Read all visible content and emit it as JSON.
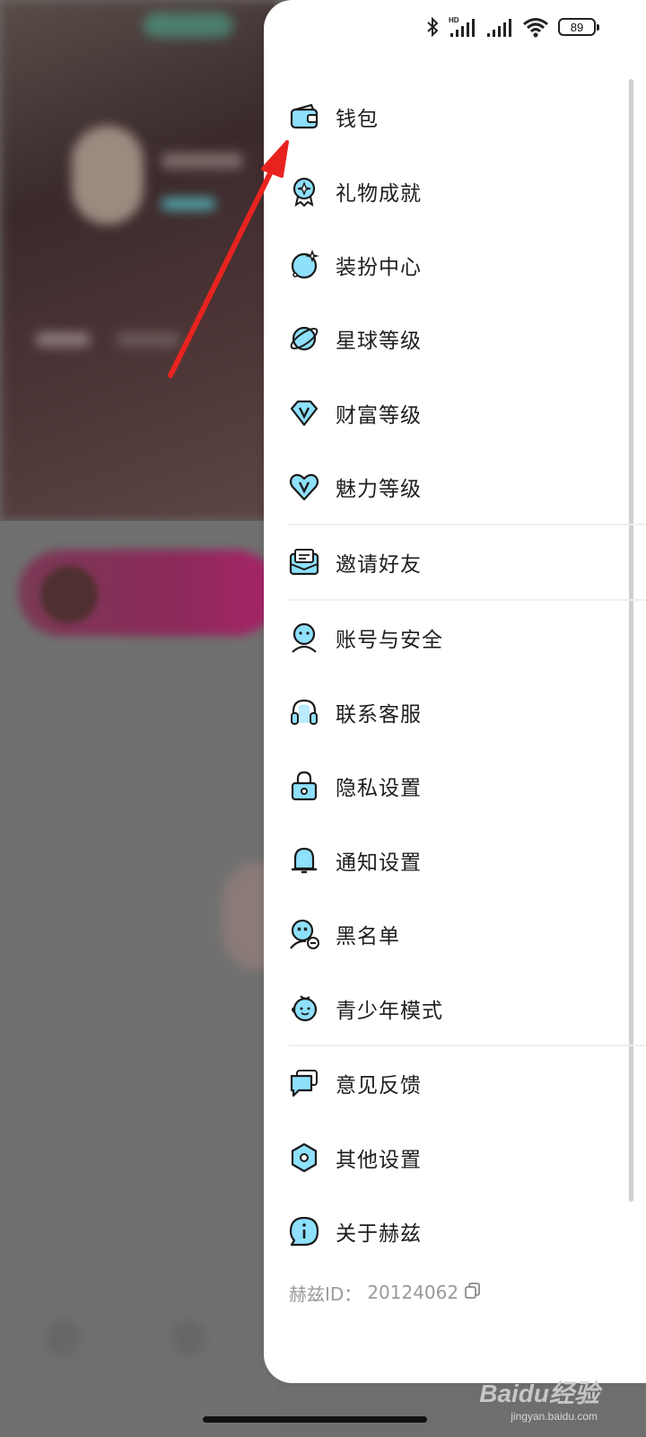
{
  "status_bar": {
    "battery": "89",
    "network_badge": "HD"
  },
  "menu": {
    "items": [
      {
        "label": "钱包",
        "icon": "wallet-icon"
      },
      {
        "label": "礼物成就",
        "icon": "gift-medal-icon"
      },
      {
        "label": "装扮中心",
        "icon": "planet-sparkle-icon"
      },
      {
        "label": "星球等级",
        "icon": "planet-ring-icon"
      },
      {
        "label": "财富等级",
        "icon": "diamond-v-icon"
      },
      {
        "label": "魅力等级",
        "icon": "heart-v-icon"
      },
      {
        "label": "邀请好友",
        "icon": "envelope-icon"
      },
      {
        "label": "账号与安全",
        "icon": "account-face-icon"
      },
      {
        "label": "联系客服",
        "icon": "headset-icon"
      },
      {
        "label": "隐私设置",
        "icon": "lock-icon"
      },
      {
        "label": "通知设置",
        "icon": "bell-icon"
      },
      {
        "label": "黑名单",
        "icon": "blocked-user-icon"
      },
      {
        "label": "青少年模式",
        "icon": "child-face-icon"
      },
      {
        "label": "意见反馈",
        "icon": "feedback-chat-icon"
      },
      {
        "label": "其他设置",
        "icon": "hexagon-gear-icon"
      },
      {
        "label": "关于赫兹",
        "icon": "info-chat-icon"
      }
    ]
  },
  "footer": {
    "id_label": "赫兹ID：",
    "id_value": "20124062"
  },
  "watermark": {
    "brand": "Baidu经验",
    "url": "jingyan.baidu.com"
  },
  "colors": {
    "accent": "#37b6f0",
    "annotation_arrow": "#e8231f"
  }
}
